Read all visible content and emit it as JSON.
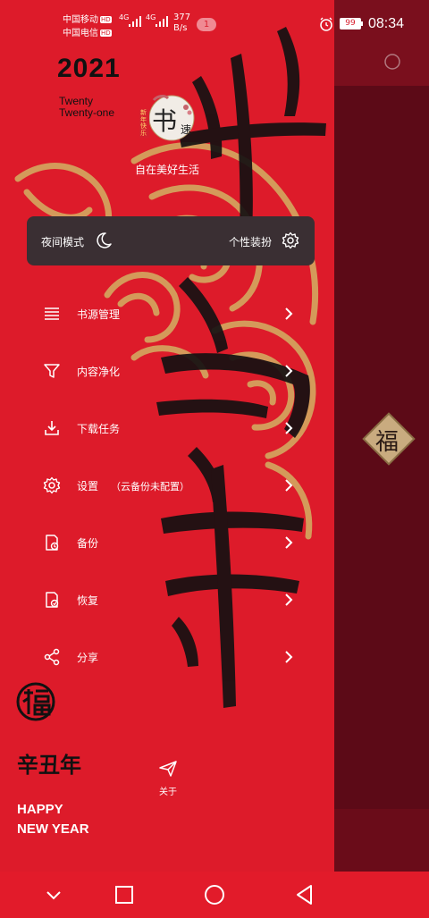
{
  "status_bar": {
    "carrier1": "中国移动",
    "carrier2": "中国电信",
    "hd1": "HD",
    "hd2": "HD",
    "net1": "4G",
    "net2": "4G",
    "speed_value": "377",
    "speed_unit": "B/s",
    "notification_count": "1",
    "battery": "99",
    "time": "08:34"
  },
  "header": {
    "year": "2021",
    "year_words_line1": "Twenty",
    "year_words_line2": "Twenty-one",
    "logo_char": "书",
    "logo_char2": "速",
    "logo_seal": "新年快乐",
    "slogan": "自在美好生活"
  },
  "mode_card": {
    "night_mode_label": "夜间模式",
    "theme_label": "个性装扮"
  },
  "menu": [
    {
      "label": "书源管理",
      "icon": "list-icon"
    },
    {
      "label": "内容净化",
      "icon": "filter-icon"
    },
    {
      "label": "下载任务",
      "icon": "download-icon"
    },
    {
      "label": "设置",
      "sub": "（云备份未配置）",
      "icon": "gear-icon"
    },
    {
      "label": "备份",
      "icon": "backup-icon"
    },
    {
      "label": "恢复",
      "icon": "restore-icon"
    },
    {
      "label": "分享",
      "icon": "share-icon"
    }
  ],
  "footer": {
    "about_label": "关于",
    "ganzhi": "辛丑年",
    "happy_line1": "HAPPY",
    "happy_line2": "NEW YEAR"
  },
  "overlay": {
    "fu_char": "福"
  },
  "colors": {
    "drawer_red": "#dd1b2a",
    "scrim": "#5c0a17",
    "card": "#3a2f33",
    "gold": "#d4a860",
    "ink": "#111111"
  }
}
